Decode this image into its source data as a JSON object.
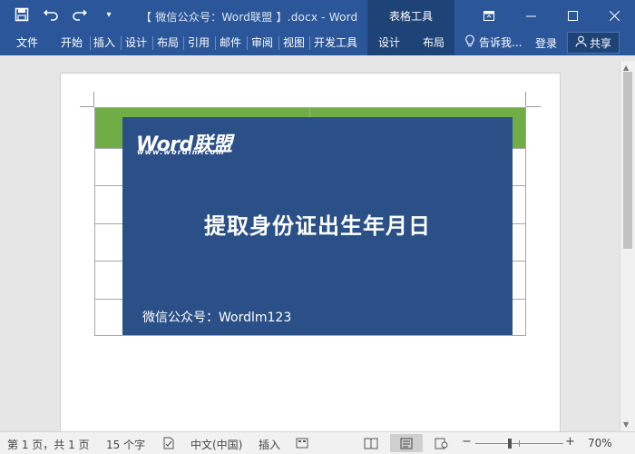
{
  "titlebar": {
    "qat": [
      {
        "name": "save-icon",
        "glyph": "💾"
      },
      {
        "name": "undo-icon",
        "glyph": "↶"
      },
      {
        "name": "redo-icon",
        "glyph": "↷"
      },
      {
        "name": "customize-qat-icon",
        "glyph": "▾"
      }
    ],
    "doc_title": "【 微信公众号：Word联盟 】.docx - Word",
    "context_group": "表格工具",
    "controls": [
      {
        "name": "ribbon-display-icon",
        "glyph": "▣"
      },
      {
        "name": "minimize-icon",
        "glyph": "—"
      },
      {
        "name": "maximize-icon",
        "glyph": "☐"
      },
      {
        "name": "close-icon",
        "glyph": "✕"
      }
    ]
  },
  "ribbon": {
    "tabs": [
      "文件",
      "开始",
      "插入",
      "设计",
      "布局",
      "引用",
      "邮件",
      "审阅",
      "视图",
      "开发工具"
    ],
    "context_tabs": [
      "设计",
      "布局"
    ],
    "tell_me": "告诉我...",
    "login": "登录",
    "share": "共享"
  },
  "banner": {
    "logo": "Word联盟",
    "logo_url": "www.wordlm.com",
    "title": "提取身份证出生年月日",
    "subtitle": "微信公众号：Wordlm123"
  },
  "statusbar": {
    "page": "第 1 页，共 1 页",
    "words": "15 个字",
    "language": "中文(中国)",
    "mode": "插入",
    "zoom_out": "−",
    "zoom_in": "+",
    "zoom": "70%"
  },
  "colors": {
    "ribbon": "#2b579a",
    "context": "#1e4377",
    "table_header": "#70ad47",
    "banner": "#2b5087"
  }
}
